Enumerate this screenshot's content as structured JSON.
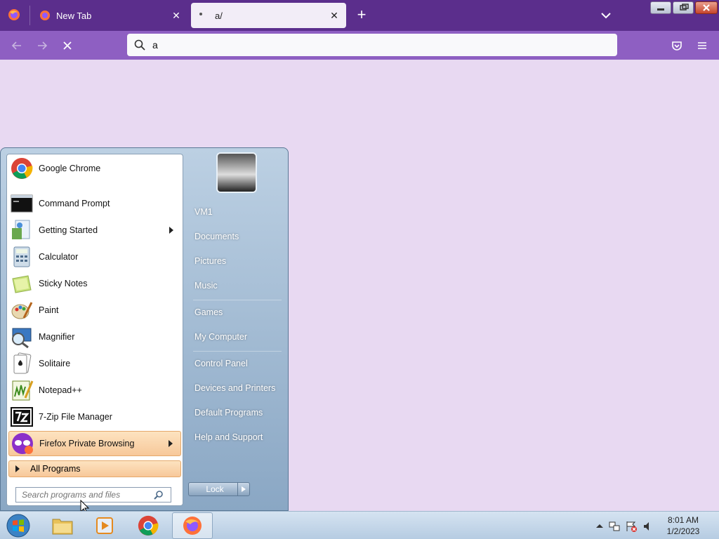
{
  "browser": {
    "tabs": [
      {
        "title": "New Tab"
      },
      {
        "title": "a/"
      }
    ],
    "url_value": "a",
    "accent": "#5b2e8c"
  },
  "start_menu": {
    "programs": [
      {
        "label": "Google Chrome"
      },
      {
        "label": "Command Prompt"
      },
      {
        "label": "Getting Started"
      },
      {
        "label": "Calculator"
      },
      {
        "label": "Sticky Notes"
      },
      {
        "label": "Paint"
      },
      {
        "label": "Magnifier"
      },
      {
        "label": "Solitaire"
      },
      {
        "label": "Notepad++"
      },
      {
        "label": "7-Zip File Manager"
      },
      {
        "label": "Firefox Private Browsing"
      }
    ],
    "all_programs": "All Programs",
    "search_placeholder": "Search programs and files",
    "right_links": [
      {
        "label": "VM1"
      },
      {
        "label": "Documents"
      },
      {
        "label": "Pictures"
      },
      {
        "label": "Music"
      },
      {
        "label": "Games"
      },
      {
        "label": "My Computer"
      },
      {
        "label": "Control Panel"
      },
      {
        "label": "Devices and Printers"
      },
      {
        "label": "Default Programs"
      },
      {
        "label": "Help and Support"
      }
    ],
    "lock_label": "Lock"
  },
  "taskbar": {
    "time": "8:01 AM",
    "date": "1/2/2023"
  }
}
